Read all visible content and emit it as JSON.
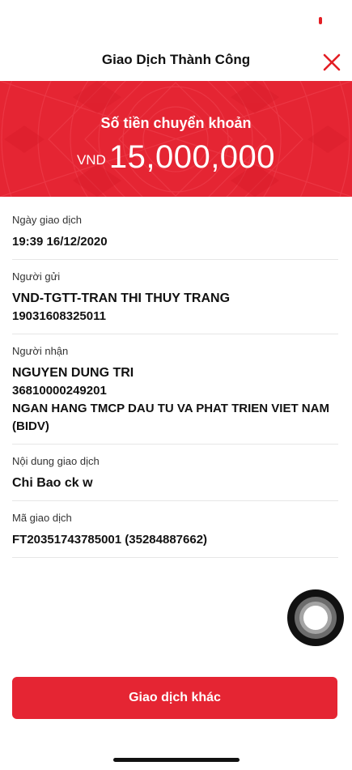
{
  "header": {
    "title": "Giao Dịch Thành Công",
    "close_icon": "close-icon"
  },
  "banner": {
    "label": "Số tiền chuyển khoản",
    "currency": "VND",
    "amount": "15,000,000"
  },
  "details": {
    "date": {
      "label": "Ngày giao dịch",
      "value": "19:39 16/12/2020"
    },
    "sender": {
      "label": "Người gửi",
      "name": "VND-TGTT-TRAN THI THUY TRANG",
      "account": "19031608325011"
    },
    "receiver": {
      "label": "Người nhận",
      "name": "NGUYEN DUNG TRI",
      "account": "36810000249201",
      "bank": "NGAN HANG TMCP DAU TU VA PHAT TRIEN VIET NAM (BIDV)"
    },
    "content": {
      "label": "Nội dung giao dịch",
      "value": "Chi Bao ck w"
    },
    "transaction_id": {
      "label": "Mã giao dịch",
      "value": "FT20351743785001 (35284887662)"
    }
  },
  "actions": {
    "new_transaction_label": "Giao dịch khác"
  },
  "colors": {
    "brand_red": "#e52533",
    "text": "#111111",
    "divider": "#e6e6e6"
  }
}
